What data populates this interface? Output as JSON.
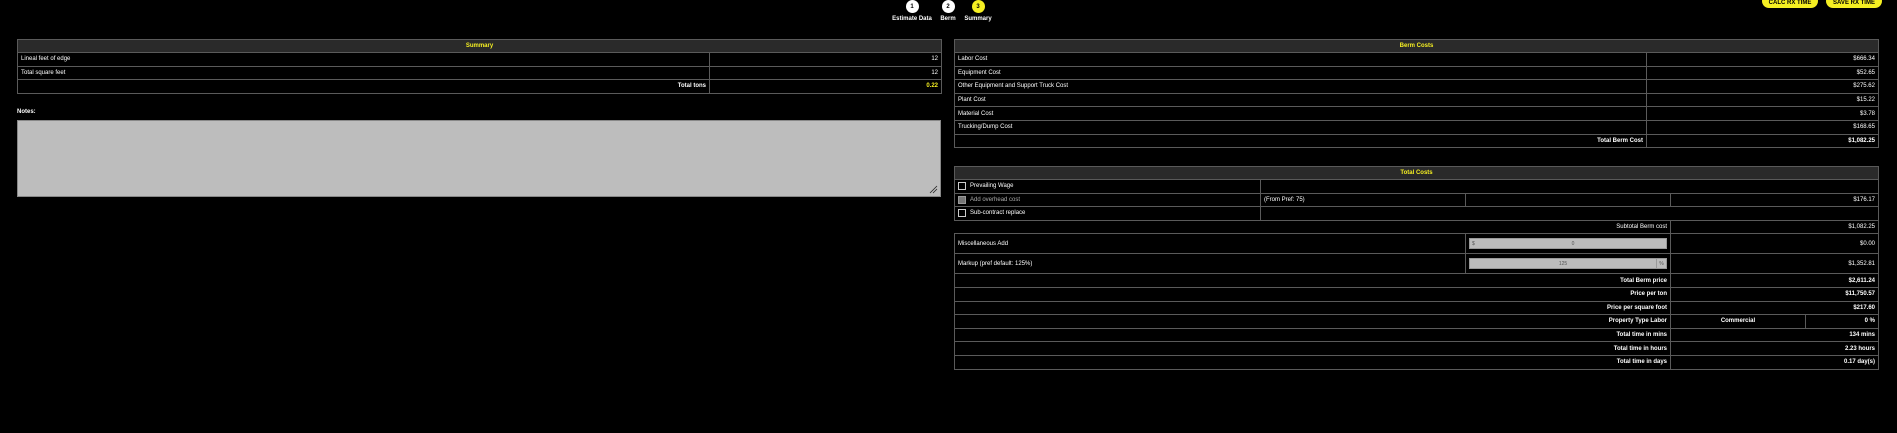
{
  "buttons": {
    "calc": "CALC RX TIME",
    "save": "SAVE RX TIME"
  },
  "steps": [
    {
      "num": "1",
      "label": "Estimate Data",
      "color": "#ffffff"
    },
    {
      "num": "2",
      "label": "Berm",
      "color": "#ffffff"
    },
    {
      "num": "3",
      "label": "Summary",
      "color": "#f5ef22"
    }
  ],
  "summary": {
    "title": "Summary",
    "rows": [
      {
        "label": "Lineal feet of edge",
        "value": "12"
      },
      {
        "label": "Total square feet",
        "value": "12"
      }
    ],
    "total_label": "Total tons",
    "total_value": "0.22"
  },
  "notes": {
    "label": "Notes:",
    "value": ""
  },
  "berm_costs": {
    "title": "Berm Costs",
    "rows": [
      {
        "label": "Labor Cost",
        "value": "$666.34"
      },
      {
        "label": "Equipment Cost",
        "value": "$52.65"
      },
      {
        "label": "Other Equipment and Support Truck Cost",
        "value": "$275.62"
      },
      {
        "label": "Plant Cost",
        "value": "$15.22"
      },
      {
        "label": "Material Cost",
        "value": "$3.78"
      },
      {
        "label": "Trucking/Dump Cost",
        "value": "$168.65"
      }
    ],
    "total_label": "Total Berm Cost",
    "total_value": "$1,082.25"
  },
  "total_costs": {
    "title": "Total Costs",
    "prevailing_wage": "Prevailing Wage",
    "overhead_label": "Add overhead cost",
    "overhead_from": "(From Pref: 75)",
    "overhead_value": "$176.17",
    "subcontract": "Sub-contract replace",
    "subtotal_label": "Subtotal Berm cost",
    "subtotal_value": "$1,082.25",
    "misc_label": "Miscellaneous Add",
    "misc_prefix": "$",
    "misc_input": "0",
    "misc_value": "$0.00",
    "markup_label": "Markup (pref default: 125%)",
    "markup_input": "125",
    "markup_suffix": "%",
    "markup_value": "$1,352.81",
    "total_berm_price_label": "Total Berm price",
    "total_berm_price_value": "$2,611.24",
    "price_per_ton_label": "Price per ton",
    "price_per_ton_value": "$11,750.57",
    "price_per_sqft_label": "Price per square foot",
    "price_per_sqft_value": "$217.60",
    "property_type_label": "Property Type Labor",
    "property_type_value": "Commercial",
    "property_type_pct": "0 %",
    "time_mins_label": "Total time in mins",
    "time_mins_value": "134 mins",
    "time_hours_label": "Total time in hours",
    "time_hours_value": "2.23 hours",
    "time_days_label": "Total time in days",
    "time_days_value": "0.17 day(s)"
  },
  "colors": {
    "accent": "#f5ef22",
    "background": "#000000",
    "header_bg": "#2a2a2a",
    "notes_bg": "#bdbdbd"
  }
}
